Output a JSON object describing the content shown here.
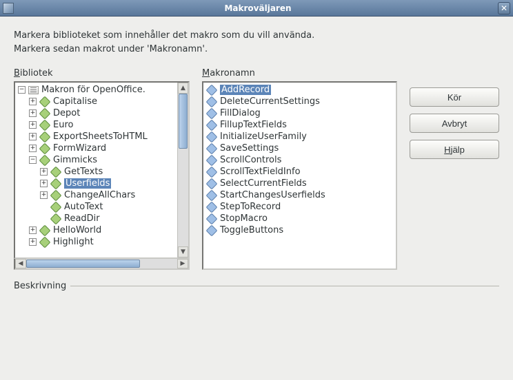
{
  "window": {
    "title": "Makroväljaren"
  },
  "intro": {
    "line1": "Markera biblioteket som innehåller det makro som du vill använda.",
    "line2": "Markera sedan makrot under 'Makronamn'."
  },
  "labels": {
    "library_u": "B",
    "library_rest": "ibliotek",
    "macroname_u": "M",
    "macroname_rest": "akronamn",
    "description": "Beskrivning"
  },
  "buttons": {
    "run": "Kör",
    "cancel": "Avbryt",
    "help_u": "H",
    "help_rest": "jälp"
  },
  "tree": {
    "root": "Makron för OpenOffice.",
    "items": [
      "Capitalise",
      "Depot",
      "Euro",
      "ExportSheetsToHTML",
      "FormWizard",
      "Gimmicks",
      "HelloWorld",
      "Highlight"
    ],
    "gimmicks_children": [
      "GetTexts",
      "Userfields",
      "ChangeAllChars",
      "AutoText",
      "ReadDir"
    ],
    "selected": "Userfields"
  },
  "macros": {
    "items": [
      "AddRecord",
      "DeleteCurrentSettings",
      "FillDialog",
      "FillupTextFields",
      "InitializeUserFamily",
      "SaveSettings",
      "ScrollControls",
      "ScrollTextFieldInfo",
      "SelectCurrentFields",
      "StartChangesUserfields",
      "StepToRecord",
      "StopMacro",
      "ToggleButtons"
    ],
    "selected": "AddRecord"
  }
}
